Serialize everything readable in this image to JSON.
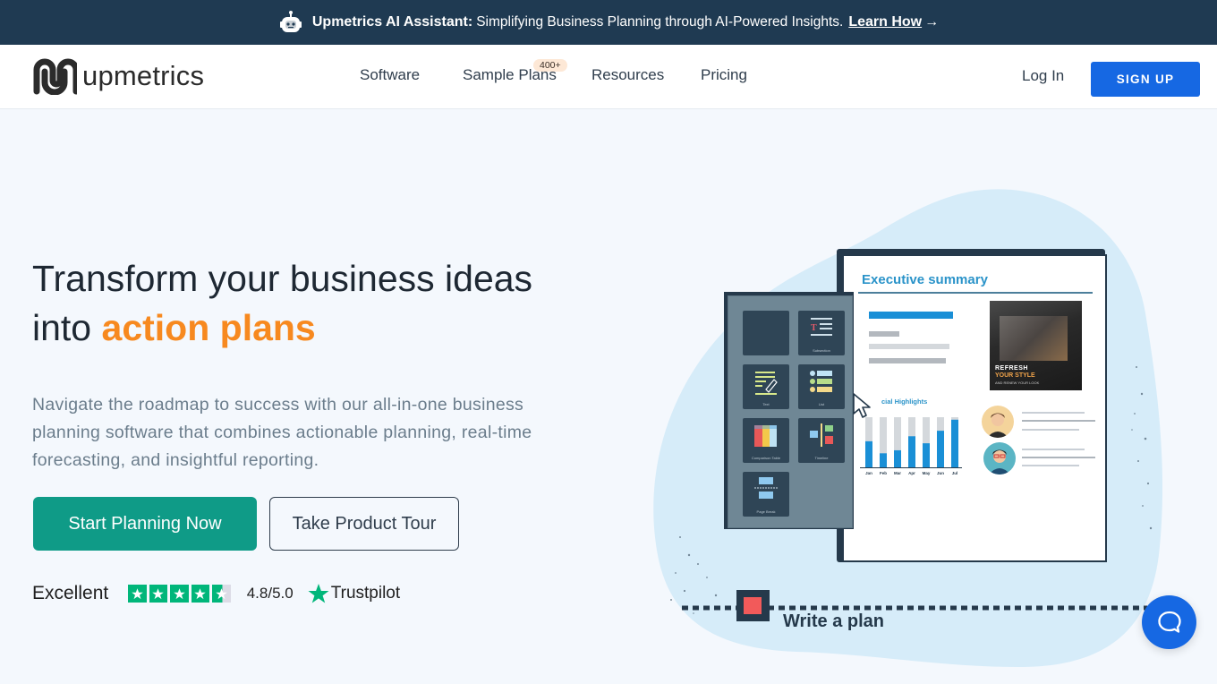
{
  "announcement": {
    "icon": "robot-icon",
    "title": "Upmetrics AI Assistant:",
    "description": "Simplifying Business Planning through AI-Powered Insights.",
    "link_label": "Learn How",
    "link_icon": "arrow-right-icon"
  },
  "header": {
    "logo_text": "upmetrics",
    "nav": [
      {
        "label": "Software"
      },
      {
        "label": "Sample Plans",
        "badge": "400+"
      },
      {
        "label": "Resources"
      },
      {
        "label": "Pricing"
      }
    ],
    "login_label": "Log In",
    "signup_label": "SIGN UP"
  },
  "hero": {
    "headline_part1": "Transform your business ideas",
    "headline_part2": "into",
    "headline_accent": "action plans",
    "subheadline": "Navigate the roadmap to success with our all-in-one business planning software that combines actionable planning, real-time forecasting, and insightful reporting.",
    "primary_cta": "Start Planning Now",
    "secondary_cta": "Take Product Tour",
    "rating": {
      "label": "Excellent",
      "stars": 4.5,
      "score": "4.8/5.0",
      "provider": "Trustpilot"
    }
  },
  "illustration": {
    "doc_title": "Executive summary",
    "chart_title": "cial Highlights",
    "photo_text": [
      "REFRESH",
      "YOUR STYLE",
      "AND RENEW YOUR LOOK"
    ],
    "tiles": [
      "",
      "Subsection",
      "Text",
      "List",
      "Comparison Table",
      "Timeline",
      "Page Break"
    ],
    "step_label": "Write a plan",
    "mini_chart": {
      "months": [
        "Jan",
        "Feb",
        "Mar",
        "Apr",
        "May",
        "Jun",
        "Jul"
      ],
      "values": [
        0.52,
        0.28,
        0.34,
        0.62,
        0.48,
        0.73,
        0.95
      ]
    }
  },
  "chat": {
    "icon": "chat-bubble-icon"
  },
  "colors": {
    "announce_bg": "#1f3a52",
    "brand_blue": "#1668e3",
    "accent_orange": "#f7891f",
    "cta_teal": "#0f9b87",
    "trustpilot_green": "#00b67a"
  }
}
